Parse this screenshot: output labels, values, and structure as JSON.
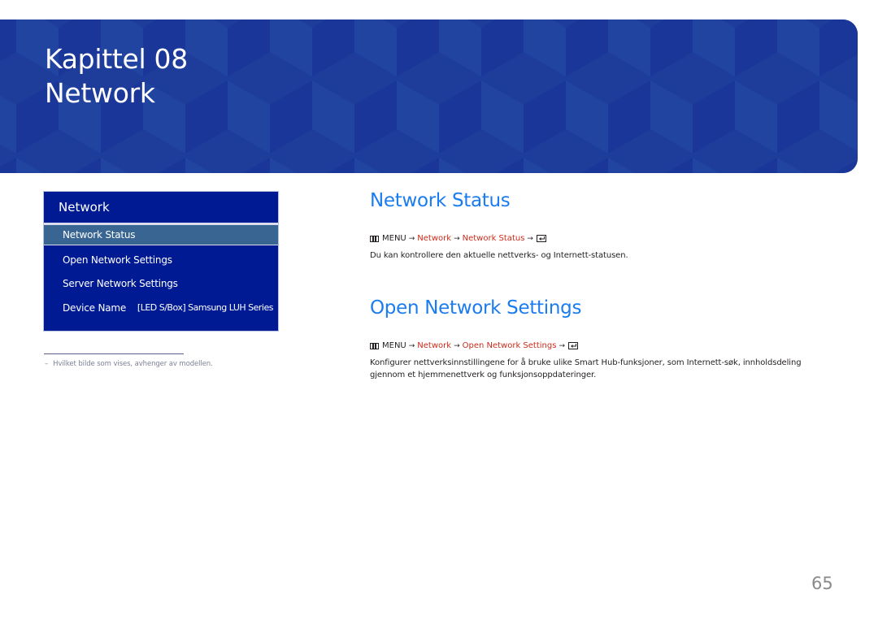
{
  "banner": {
    "chapter": "Kapittel 08",
    "title": "Network",
    "colors": {
      "background": "#1e3d9a",
      "cube_light": "#2144a0",
      "cube_dark": "#1a3699"
    }
  },
  "menu_panel": {
    "header": "Network",
    "items": [
      {
        "label": "Network Status",
        "value": "",
        "selected": true
      },
      {
        "label": "Open Network Settings",
        "value": "",
        "selected": false
      },
      {
        "label": "Server Network Settings",
        "value": "",
        "selected": false
      },
      {
        "label": "Device Name",
        "value": "[LED S/Box] Samsung LUH Series",
        "selected": false
      }
    ],
    "colors": {
      "background": "#001a94",
      "selected": "#386592"
    }
  },
  "footnote": {
    "dash": "–",
    "text": "Hvilket bilde som vises, avhenger av modellen."
  },
  "sections": [
    {
      "title": "Network Status",
      "path": {
        "menu_icon": "menu-icon",
        "menu_label": "MENU",
        "arrow": "→",
        "steps": [
          "Network",
          "Network Status"
        ],
        "end_icon": "enter-icon"
      },
      "body": "Du kan kontrollere den aktuelle nettverks- og Internett-statusen."
    },
    {
      "title": "Open Network Settings",
      "path": {
        "menu_icon": "menu-icon",
        "menu_label": "MENU",
        "arrow": "→",
        "steps": [
          "Network",
          "Open Network Settings"
        ],
        "end_icon": "enter-icon"
      },
      "body": "Konfigurer nettverksinnstillingene for å bruke ulike Smart Hub-funksjoner, som Internett-søk, innholdsdeling gjennom et hjemmenettverk og funksjonsoppdateringer."
    }
  ],
  "colors": {
    "section_title": "#1b7cf0",
    "path_link": "#cc2b1a"
  },
  "page_number": "65"
}
